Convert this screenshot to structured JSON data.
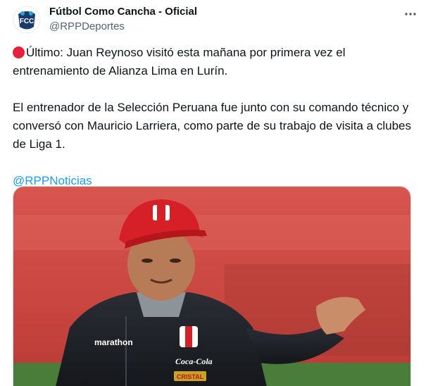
{
  "account": {
    "display_name": "Fútbol Como Cancha - Oficial",
    "handle": "@RPPDeportes",
    "avatar_text": "FCC"
  },
  "tweet": {
    "line1_text": "Último: Juan Reynoso visitó esta mañana por primera vez el entrenamiento de Alianza Lima en Lurín.",
    "paragraph2": "El entrenador de la Selección Peruana fue junto con su comando técnico y conversó con Mauricio Larriera, como parte de su trabajo de visita a clubes de Liga 1.",
    "mention": "@RPPNoticias"
  },
  "media": {
    "jacket_brand": "marathon",
    "sponsor1": "Coca-Cola",
    "sponsor2": "CRISTAL"
  },
  "colors": {
    "mention": "#1d9bf0",
    "red_dot": "#e5203a",
    "secondary_text": "#536471"
  }
}
